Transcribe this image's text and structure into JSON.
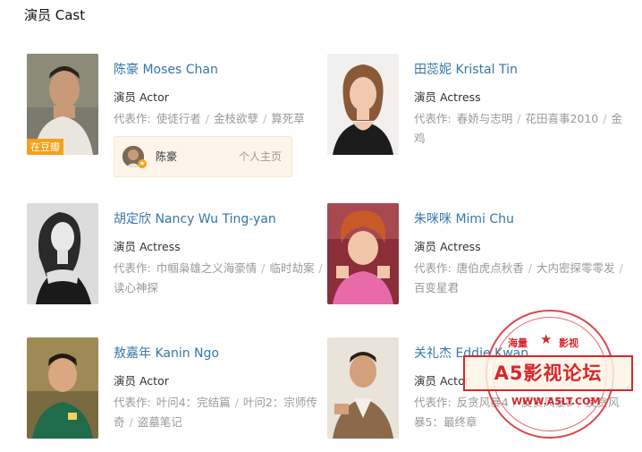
{
  "section_title": "演员 Cast",
  "works_label": "代表作:",
  "cast": [
    {
      "name": "陈豪 Moses Chan",
      "role": "演员 Actor",
      "works": [
        "使徒行者",
        "金枝欲孽",
        "算死草"
      ],
      "badge": "在豆瓣",
      "homepage": {
        "name": "陈豪",
        "link": "个人主页"
      }
    },
    {
      "name": "田蕊妮 Kristal Tin",
      "role": "演员 Actress",
      "works": [
        "春娇与志明",
        "花田喜事2010",
        "金鸡"
      ]
    },
    {
      "name": "胡定欣 Nancy Wu Ting-yan",
      "role": "演员 Actress",
      "works": [
        "巾帼枭雄之义海豪情",
        "临时劫案",
        "读心神探"
      ]
    },
    {
      "name": "朱咪咪 Mimi Chu",
      "role": "演员 Actress",
      "works": [
        "唐伯虎点秋香",
        "大内密探零零发",
        "百变星君"
      ]
    },
    {
      "name": "敖嘉年 Kanin Ngo",
      "role": "演员 Actor",
      "works": [
        "叶问4：完结篇",
        "叶问2：宗师传奇",
        "盗墓笔记"
      ]
    },
    {
      "name": "关礼杰 Eddie Kwan",
      "role": "演员 Actor",
      "works": [
        "反贪风暴4",
        "反贪风暴3",
        "反贪风暴5：最终章"
      ]
    }
  ],
  "watermark": {
    "top_left": "海量",
    "top_right": "影视",
    "brand": "A5影视论坛",
    "url": "WWW.A5LT.COM"
  }
}
